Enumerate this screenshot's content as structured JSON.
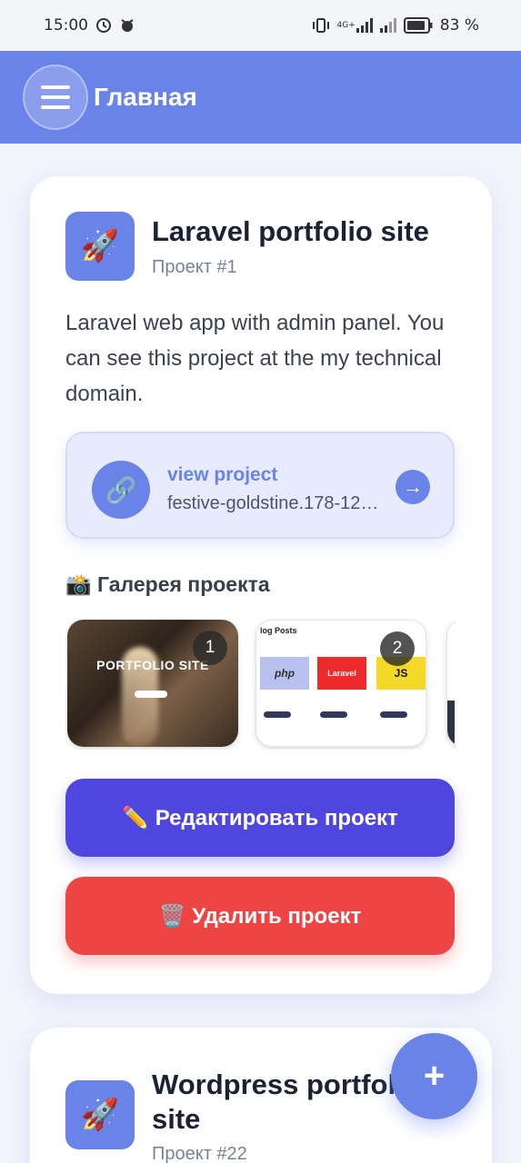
{
  "status_bar": {
    "time": "15:00",
    "network": "4G+",
    "battery": "83 %"
  },
  "app_bar": {
    "title": "Главная",
    "menu_icon": "hamburger-menu-icon"
  },
  "projects": [
    {
      "title": "Laravel portfolio site",
      "subtitle": "Проект #1",
      "icon": "🚀",
      "description": "Laravel web app with admin panel. You can see this project at the my technical domain.",
      "link": {
        "label": "view project",
        "url": "festive-goldstine.178-12…",
        "icon": "🔗",
        "arrow": "→"
      },
      "gallery": {
        "title": "📸 Галерея проекта",
        "items": [
          {
            "badge": "1",
            "text": "PORTFOLIO SITE"
          },
          {
            "badge": "2",
            "text": "log Posts",
            "tags": [
              "php",
              "Laravel",
              "JS"
            ]
          },
          {
            "badge": "",
            "text": ""
          }
        ]
      },
      "edit_button": "✏️ Редактировать проект",
      "delete_button": "🗑️ Удалить проект"
    },
    {
      "title": "Wordpress portfolio site",
      "subtitle": "Проект #22",
      "icon": "🚀"
    }
  ],
  "fab": {
    "label": "+"
  },
  "colors": {
    "primary": "#6a83e8",
    "edit": "#4f46e0",
    "delete": "#ef4444",
    "background": "#f3f5fc"
  }
}
